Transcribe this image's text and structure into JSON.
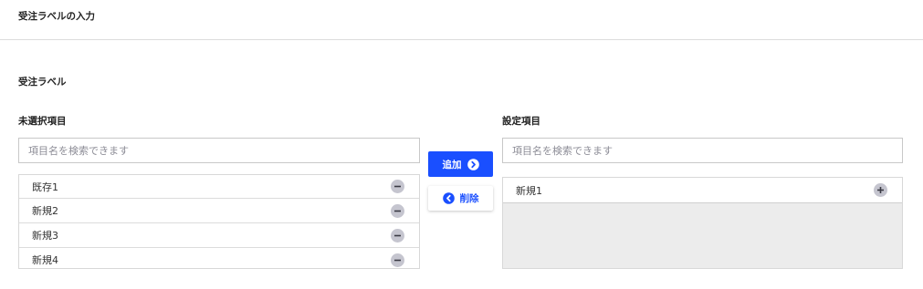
{
  "header": {
    "title": "受注ラベルの入力"
  },
  "section": {
    "title": "受注ラベル"
  },
  "unselected": {
    "label": "未選択項目",
    "search_placeholder": "項目名を検索できます",
    "items": [
      {
        "label": "既存1"
      },
      {
        "label": "新規2"
      },
      {
        "label": "新規3"
      },
      {
        "label": "新規4"
      }
    ]
  },
  "selected": {
    "label": "設定項目",
    "search_placeholder": "項目名を検索できます",
    "items": [
      {
        "label": "新規1"
      }
    ]
  },
  "actions": {
    "add_label": "追加",
    "remove_label": "削除"
  },
  "colors": {
    "primary": "#1a4fff",
    "row_icon_bg": "#c5c5cf",
    "empty_area": "#ececec"
  },
  "icons": {
    "add": "chevron-right-circle-icon",
    "remove": "chevron-left-circle-icon",
    "row_unselected": "minus-circle-icon",
    "row_selected": "plus-circle-icon"
  }
}
